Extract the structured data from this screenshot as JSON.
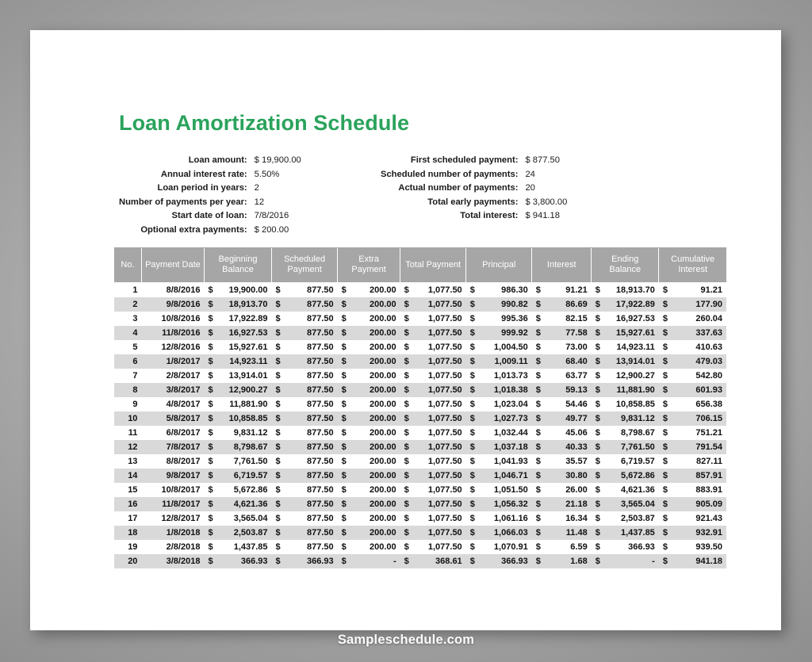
{
  "document": {
    "title": "Loan Amortization Schedule",
    "title_color": "#2aa35c",
    "watermark": "Sampleschedule.com"
  },
  "summary_left": [
    {
      "label": "Loan amount:",
      "value": "$ 19,900.00"
    },
    {
      "label": "Annual interest rate:",
      "value": "5.50%"
    },
    {
      "label": "Loan period in years:",
      "value": "2"
    },
    {
      "label": "Number of payments per year:",
      "value": "12"
    },
    {
      "label": "Start date of loan:",
      "value": "7/8/2016"
    },
    {
      "label": "Optional extra payments:",
      "value": "$ 200.00"
    }
  ],
  "summary_right": [
    {
      "label": "First scheduled payment:",
      "value": "$ 877.50"
    },
    {
      "label": "Scheduled number of payments:",
      "value": "24"
    },
    {
      "label": "Actual number of payments:",
      "value": "20"
    },
    {
      "label": "Total early payments:",
      "value": "$ 3,800.00"
    },
    {
      "label": "Total interest:",
      "value": "$ 941.18"
    }
  ],
  "table": {
    "header_bg": "#a6a6a6",
    "band_bg": "#d9d9d9",
    "columns": [
      "No.",
      "Payment Date",
      "Beginning Balance",
      "Scheduled Payment",
      "Extra Payment",
      "Total Payment",
      "Principal",
      "Interest",
      "Ending Balance",
      "Cumulative Interest"
    ],
    "currency_symbol": "$",
    "rows": [
      {
        "no": "1",
        "date": "8/8/2016",
        "beginning": "19,900.00",
        "scheduled": "877.50",
        "extra": "200.00",
        "total": "1,077.50",
        "principal": "986.30",
        "interest": "91.21",
        "ending": "18,913.70",
        "cumulative": "91.21"
      },
      {
        "no": "2",
        "date": "9/8/2016",
        "beginning": "18,913.70",
        "scheduled": "877.50",
        "extra": "200.00",
        "total": "1,077.50",
        "principal": "990.82",
        "interest": "86.69",
        "ending": "17,922.89",
        "cumulative": "177.90"
      },
      {
        "no": "3",
        "date": "10/8/2016",
        "beginning": "17,922.89",
        "scheduled": "877.50",
        "extra": "200.00",
        "total": "1,077.50",
        "principal": "995.36",
        "interest": "82.15",
        "ending": "16,927.53",
        "cumulative": "260.04"
      },
      {
        "no": "4",
        "date": "11/8/2016",
        "beginning": "16,927.53",
        "scheduled": "877.50",
        "extra": "200.00",
        "total": "1,077.50",
        "principal": "999.92",
        "interest": "77.58",
        "ending": "15,927.61",
        "cumulative": "337.63"
      },
      {
        "no": "5",
        "date": "12/8/2016",
        "beginning": "15,927.61",
        "scheduled": "877.50",
        "extra": "200.00",
        "total": "1,077.50",
        "principal": "1,004.50",
        "interest": "73.00",
        "ending": "14,923.11",
        "cumulative": "410.63"
      },
      {
        "no": "6",
        "date": "1/8/2017",
        "beginning": "14,923.11",
        "scheduled": "877.50",
        "extra": "200.00",
        "total": "1,077.50",
        "principal": "1,009.11",
        "interest": "68.40",
        "ending": "13,914.01",
        "cumulative": "479.03"
      },
      {
        "no": "7",
        "date": "2/8/2017",
        "beginning": "13,914.01",
        "scheduled": "877.50",
        "extra": "200.00",
        "total": "1,077.50",
        "principal": "1,013.73",
        "interest": "63.77",
        "ending": "12,900.27",
        "cumulative": "542.80"
      },
      {
        "no": "8",
        "date": "3/8/2017",
        "beginning": "12,900.27",
        "scheduled": "877.50",
        "extra": "200.00",
        "total": "1,077.50",
        "principal": "1,018.38",
        "interest": "59.13",
        "ending": "11,881.90",
        "cumulative": "601.93"
      },
      {
        "no": "9",
        "date": "4/8/2017",
        "beginning": "11,881.90",
        "scheduled": "877.50",
        "extra": "200.00",
        "total": "1,077.50",
        "principal": "1,023.04",
        "interest": "54.46",
        "ending": "10,858.85",
        "cumulative": "656.38"
      },
      {
        "no": "10",
        "date": "5/8/2017",
        "beginning": "10,858.85",
        "scheduled": "877.50",
        "extra": "200.00",
        "total": "1,077.50",
        "principal": "1,027.73",
        "interest": "49.77",
        "ending": "9,831.12",
        "cumulative": "706.15"
      },
      {
        "no": "11",
        "date": "6/8/2017",
        "beginning": "9,831.12",
        "scheduled": "877.50",
        "extra": "200.00",
        "total": "1,077.50",
        "principal": "1,032.44",
        "interest": "45.06",
        "ending": "8,798.67",
        "cumulative": "751.21"
      },
      {
        "no": "12",
        "date": "7/8/2017",
        "beginning": "8,798.67",
        "scheduled": "877.50",
        "extra": "200.00",
        "total": "1,077.50",
        "principal": "1,037.18",
        "interest": "40.33",
        "ending": "7,761.50",
        "cumulative": "791.54"
      },
      {
        "no": "13",
        "date": "8/8/2017",
        "beginning": "7,761.50",
        "scheduled": "877.50",
        "extra": "200.00",
        "total": "1,077.50",
        "principal": "1,041.93",
        "interest": "35.57",
        "ending": "6,719.57",
        "cumulative": "827.11"
      },
      {
        "no": "14",
        "date": "9/8/2017",
        "beginning": "6,719.57",
        "scheduled": "877.50",
        "extra": "200.00",
        "total": "1,077.50",
        "principal": "1,046.71",
        "interest": "30.80",
        "ending": "5,672.86",
        "cumulative": "857.91"
      },
      {
        "no": "15",
        "date": "10/8/2017",
        "beginning": "5,672.86",
        "scheduled": "877.50",
        "extra": "200.00",
        "total": "1,077.50",
        "principal": "1,051.50",
        "interest": "26.00",
        "ending": "4,621.36",
        "cumulative": "883.91"
      },
      {
        "no": "16",
        "date": "11/8/2017",
        "beginning": "4,621.36",
        "scheduled": "877.50",
        "extra": "200.00",
        "total": "1,077.50",
        "principal": "1,056.32",
        "interest": "21.18",
        "ending": "3,565.04",
        "cumulative": "905.09"
      },
      {
        "no": "17",
        "date": "12/8/2017",
        "beginning": "3,565.04",
        "scheduled": "877.50",
        "extra": "200.00",
        "total": "1,077.50",
        "principal": "1,061.16",
        "interest": "16.34",
        "ending": "2,503.87",
        "cumulative": "921.43"
      },
      {
        "no": "18",
        "date": "1/8/2018",
        "beginning": "2,503.87",
        "scheduled": "877.50",
        "extra": "200.00",
        "total": "1,077.50",
        "principal": "1,066.03",
        "interest": "11.48",
        "ending": "1,437.85",
        "cumulative": "932.91"
      },
      {
        "no": "19",
        "date": "2/8/2018",
        "beginning": "1,437.85",
        "scheduled": "877.50",
        "extra": "200.00",
        "total": "1,077.50",
        "principal": "1,070.91",
        "interest": "6.59",
        "ending": "366.93",
        "cumulative": "939.50"
      },
      {
        "no": "20",
        "date": "3/8/2018",
        "beginning": "366.93",
        "scheduled": "366.93",
        "extra": "-",
        "total": "368.61",
        "principal": "366.93",
        "interest": "1.68",
        "ending": "-",
        "cumulative": "941.18"
      }
    ]
  }
}
